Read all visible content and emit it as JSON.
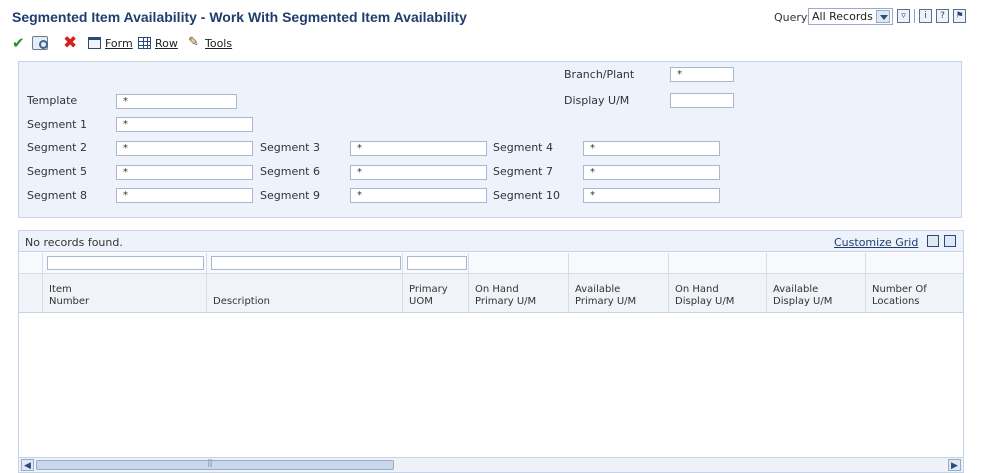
{
  "header": {
    "title": "Segmented Item Availability - Work With Segmented Item Availability",
    "query_label": "Query:",
    "query_value": "All Records"
  },
  "toolbar": {
    "form_label": "Form",
    "row_label": "Row",
    "tools_label": "Tools"
  },
  "form": {
    "branch_plant_label": "Branch/Plant",
    "branch_plant_value": "*",
    "display_um_label": "Display U/M",
    "display_um_value": "",
    "template_label": "Template",
    "template_value": "*",
    "segments": [
      {
        "label": "Segment 1",
        "value": "*"
      },
      {
        "label": "Segment 2",
        "value": "*"
      },
      {
        "label": "Segment 3",
        "value": "*"
      },
      {
        "label": "Segment 4",
        "value": "*"
      },
      {
        "label": "Segment 5",
        "value": "*"
      },
      {
        "label": "Segment 6",
        "value": "*"
      },
      {
        "label": "Segment 7",
        "value": "*"
      },
      {
        "label": "Segment 8",
        "value": "*"
      },
      {
        "label": "Segment 9",
        "value": "*"
      },
      {
        "label": "Segment 10",
        "value": "*"
      }
    ]
  },
  "grid": {
    "status": "No records found.",
    "customize_label": "Customize Grid",
    "columns": [
      "Item\nNumber",
      "Description",
      "Primary\nUOM",
      "On Hand\nPrimary U/M",
      "Available\nPrimary U/M",
      "On Hand\nDisplay U/M",
      "Available\nDisplay U/M",
      "Number Of\nLocations"
    ]
  },
  "colors": {
    "title": "#1f3e6e",
    "panel_bg": "#eef3fb",
    "ok_green": "#2e8a2e",
    "cancel_red": "#d32020"
  },
  "icons": [
    "ok-check-icon",
    "find-icon",
    "cancel-icon",
    "form-icon",
    "row-icon",
    "tools-icon",
    "filter-icon",
    "info-icon",
    "help-icon",
    "export-icon",
    "maximize-icon"
  ]
}
